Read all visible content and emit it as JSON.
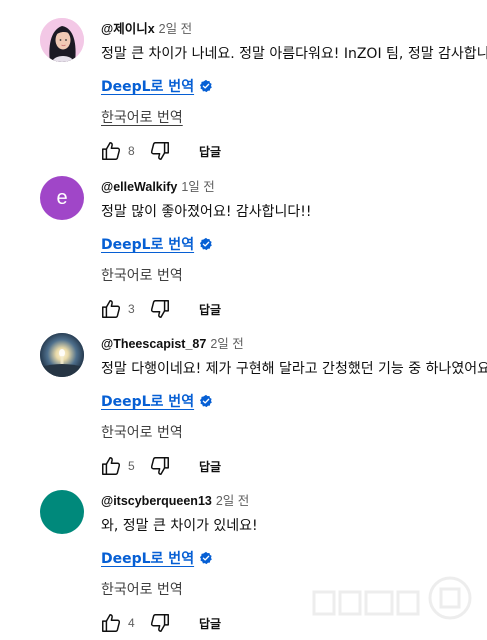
{
  "comments": [
    {
      "author": "@제이니x",
      "time": "2일 전",
      "text": "정말 큰 차이가 나네요. 정말 아름다워요! InZOI 팀, 정말 감사합니다",
      "deepl_label": "DeepL로 번역",
      "translate_label": "한국어로 번역",
      "likes": "8",
      "reply_label": "답글",
      "avatar_type": "illustration",
      "avatar_bg": "#f2c6e6"
    },
    {
      "author": "@elleWalkify",
      "time": "1일 전",
      "text": "정말 많이 좋아졌어요! 감사합니다!!",
      "deepl_label": "DeepL로 번역",
      "translate_label": "한국어로 번역",
      "likes": "3",
      "reply_label": "답글",
      "avatar_type": "letter",
      "avatar_letter": "e",
      "avatar_bg": "#a046c8"
    },
    {
      "author": "@Theescapist_87",
      "time": "2일 전",
      "text": "정말 다행이네요! 제가 구현해 달라고 간청했던 기능 중 하나였어요",
      "deepl_label": "DeepL로 번역",
      "translate_label": "한국어로 번역",
      "likes": "5",
      "reply_label": "답글",
      "avatar_type": "photo",
      "avatar_bg": "#2c4a66"
    },
    {
      "author": "@itscyberqueen13",
      "time": "2일 전",
      "text": "와, 정말 큰 차이가 있네요!",
      "deepl_label": "DeepL로 번역",
      "translate_label": "한국어로 번역",
      "likes": "4",
      "reply_label": "답글",
      "avatar_type": "solid",
      "avatar_bg": "#00897b"
    }
  ],
  "colors": {
    "link_blue": "#065fd4",
    "meta_gray": "#606060",
    "text_dark": "#0f0f0f"
  },
  "icons": {
    "like": "thumb-up-icon",
    "dislike": "thumb-down-icon",
    "deepl_badge": "verified-check-icon"
  }
}
